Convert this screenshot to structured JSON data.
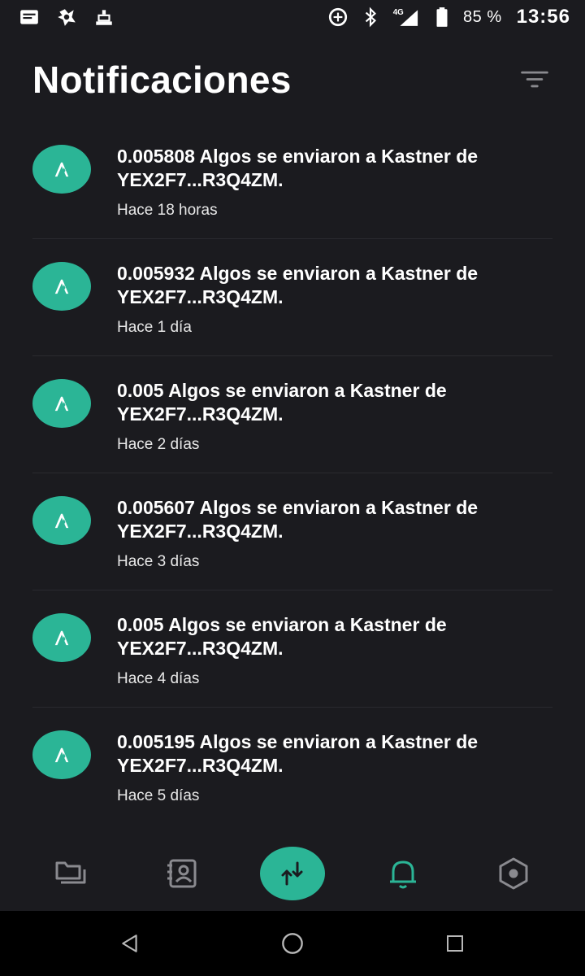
{
  "status_bar": {
    "left_icons": [
      "message-icon",
      "antivirus-icon",
      "accessibility-icon"
    ],
    "right_icons": [
      "data-saver-icon",
      "bluetooth-icon",
      "signal-4g-icon",
      "battery-icon"
    ],
    "network": "4G",
    "battery": "85 %",
    "time": "13:56"
  },
  "header": {
    "title": "Notificaciones",
    "filter_icon": "filter-icon"
  },
  "notifications": [
    {
      "message": "0.005808 Algos se enviaron a Kastner de YEX2F7...R3Q4ZM.",
      "time": "Hace 18 horas"
    },
    {
      "message": "0.005932 Algos se enviaron a Kastner de YEX2F7...R3Q4ZM.",
      "time": "Hace 1 día"
    },
    {
      "message": "0.005 Algos se enviaron a Kastner de YEX2F7...R3Q4ZM.",
      "time": "Hace 2 días"
    },
    {
      "message": "0.005607 Algos se enviaron a Kastner de YEX2F7...R3Q4ZM.",
      "time": "Hace 3 días"
    },
    {
      "message": "0.005 Algos se enviaron a Kastner de YEX2F7...R3Q4ZM.",
      "time": "Hace 4 días"
    },
    {
      "message": "0.005195 Algos se enviaron a Kastner de YEX2F7...R3Q4ZM.",
      "time": "Hace 5 días"
    }
  ],
  "bottom_nav": {
    "items": [
      "accounts-icon",
      "contacts-icon",
      "transfer-icon",
      "notifications-bell-icon",
      "settings-hexagon-icon"
    ],
    "active": "notifications-bell-icon"
  },
  "colors": {
    "background": "#1b1b1f",
    "accent": "#2bb596",
    "text": "#ffffff",
    "divider": "#2a2a2f"
  },
  "system_nav": {
    "items": [
      "back-icon",
      "home-icon",
      "recents-icon"
    ]
  }
}
